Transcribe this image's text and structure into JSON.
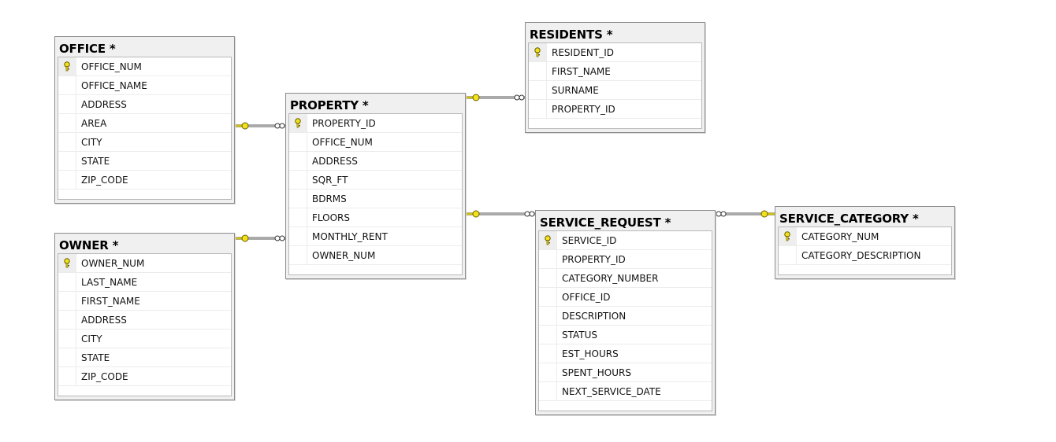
{
  "tables": [
    {
      "id": "office",
      "title": "OFFICE *",
      "columns": [
        "OFFICE_NUM",
        "OFFICE_NAME",
        "ADDRESS",
        "AREA",
        "CITY",
        "STATE",
        "ZIP_CODE"
      ],
      "primary_key": "OFFICE_NUM"
    },
    {
      "id": "residents",
      "title": "RESIDENTS *",
      "columns": [
        "RESIDENT_ID",
        "FIRST_NAME",
        "SURNAME",
        "PROPERTY_ID"
      ],
      "primary_key": "RESIDENT_ID"
    },
    {
      "id": "property",
      "title": "PROPERTY *",
      "columns": [
        "PROPERTY_ID",
        "OFFICE_NUM",
        "ADDRESS",
        "SQR_FT",
        "BDRMS",
        "FLOORS",
        "MONTHLY_RENT",
        "OWNER_NUM"
      ],
      "primary_key": "PROPERTY_ID"
    },
    {
      "id": "owner",
      "title": "OWNER *",
      "columns": [
        "OWNER_NUM",
        "LAST_NAME",
        "FIRST_NAME",
        "ADDRESS",
        "CITY",
        "STATE",
        "ZIP_CODE"
      ],
      "primary_key": "OWNER_NUM"
    },
    {
      "id": "service_request",
      "title": "SERVICE_REQUEST *",
      "columns": [
        "SERVICE_ID",
        "PROPERTY_ID",
        "CATEGORY_NUMBER",
        "OFFICE_ID",
        "DESCRIPTION",
        "STATUS",
        "EST_HOURS",
        "SPENT_HOURS",
        "NEXT_SERVICE_DATE"
      ],
      "primary_key": "SERVICE_ID"
    },
    {
      "id": "service_category",
      "title": "SERVICE_CATEGORY *",
      "columns": [
        "CATEGORY_NUM",
        "CATEGORY_DESCRIPTION"
      ],
      "primary_key": "CATEGORY_NUM"
    }
  ],
  "relationships": [
    {
      "one": "office",
      "many": "property"
    },
    {
      "one": "owner",
      "many": "property"
    },
    {
      "one": "property",
      "many": "residents"
    },
    {
      "one": "property",
      "many": "service_request"
    },
    {
      "one": "service_category",
      "many": "service_request"
    }
  ],
  "colors": {
    "key": "#f2e21a",
    "line": "#555555"
  },
  "icons": {
    "primary_key": "key-icon",
    "one_end": "key-icon",
    "many_end": "infinity-icon"
  }
}
